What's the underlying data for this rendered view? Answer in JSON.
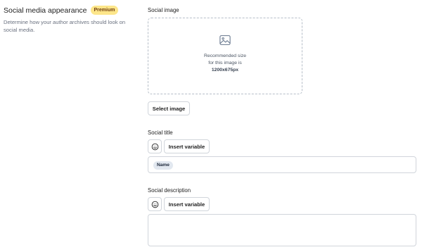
{
  "section": {
    "title": "Social media appearance",
    "badge": "Premium",
    "description": "Determine how your author archives should look on social media."
  },
  "social_image": {
    "label": "Social image",
    "recommended_line1": "Recommended size",
    "recommended_line2": "for this image is",
    "recommended_size": "1200x675px",
    "select_button": "Select image"
  },
  "social_title": {
    "label": "Social title",
    "insert_variable_button": "Insert variable",
    "chip": "Name"
  },
  "social_description": {
    "label": "Social description",
    "insert_variable_button": "Insert variable",
    "value": ""
  },
  "icons": {
    "image_placeholder": "image-icon",
    "emoji": "smiley-icon"
  }
}
